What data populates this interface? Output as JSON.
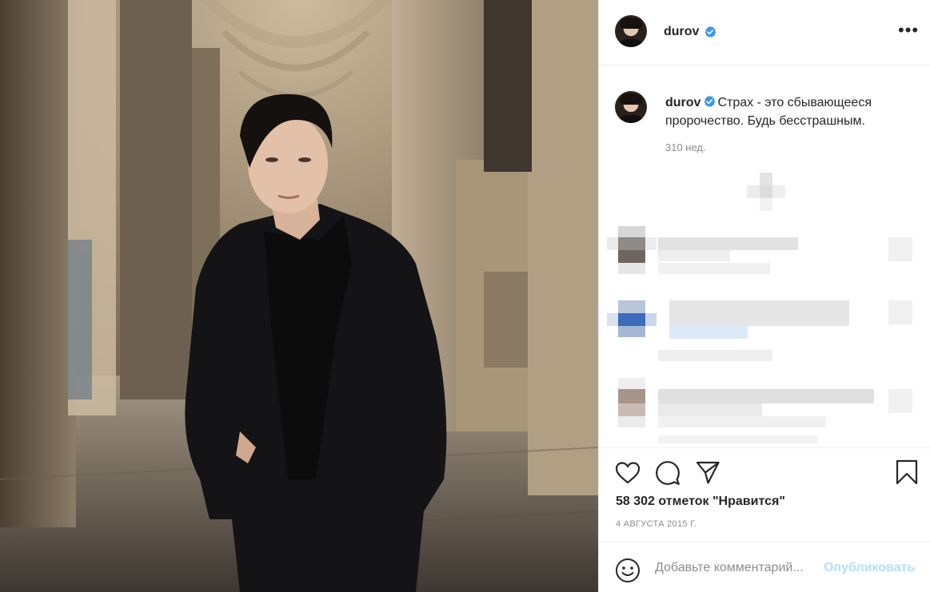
{
  "post": {
    "author": {
      "username": "durov",
      "verified": true
    },
    "caption": "Страх - это сбывающееся пророчество. Будь бесстрашным.",
    "age": "310 нед.",
    "likes_text": "58 302 отметок \"Нравится\"",
    "date": "4 АВГУСТА 2015 Г."
  },
  "comment_bar": {
    "placeholder": "Добавьте комментарий...",
    "publish_label": "Опубликовать"
  },
  "icons": {
    "more": "more-options-icon",
    "like": "heart-icon",
    "comment": "comment-icon",
    "share": "paper-plane-icon",
    "save": "bookmark-icon",
    "emoji": "emoji-icon",
    "verified": "verified-badge-icon"
  },
  "colors": {
    "verified_blue": "#3897f0",
    "link_disabled": "#b2dffc",
    "muted_text": "#8e8e8e"
  }
}
